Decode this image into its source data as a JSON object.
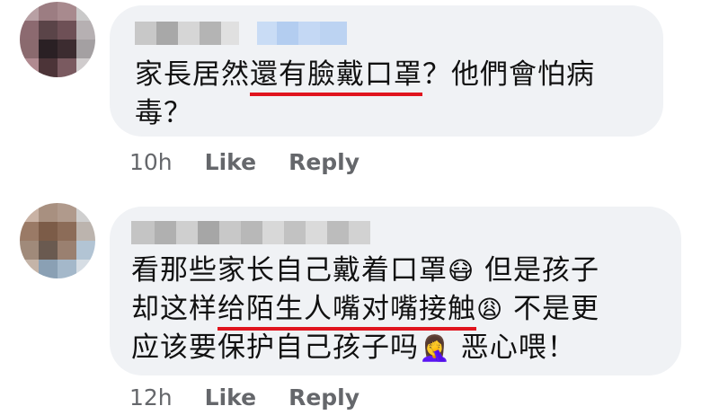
{
  "comments": [
    {
      "text_lines": [
        [
          {
            "t": "家長居然",
            "u": false
          },
          {
            "t": "還有臉戴口罩",
            "u": true
          },
          {
            "t": "？他們會怕病",
            "u": false
          }
        ],
        [
          {
            "t": "毒？",
            "u": false
          }
        ]
      ],
      "time": "10h",
      "like_label": "Like",
      "reply_label": "Reply"
    },
    {
      "text_lines": [
        [
          {
            "t": "看那些家长自己戴着口罩",
            "u": false
          },
          {
            "t": "😷",
            "u": false,
            "emoji": true
          },
          {
            "t": " 但是孩子",
            "u": false
          }
        ],
        [
          {
            "t": "却这样",
            "u": false
          },
          {
            "t": "给陌生人嘴对嘴接触",
            "u": true
          },
          {
            "t": "😩",
            "u": false,
            "emoji": true
          },
          {
            "t": " 不是更",
            "u": false
          }
        ],
        [
          {
            "t": "应该要保护自己孩子吗",
            "u": false
          },
          {
            "t": "🤦‍♀️",
            "u": false,
            "emoji": true
          },
          {
            "t": " 恶心喂！",
            "u": false
          }
        ]
      ],
      "time": "12h",
      "like_label": "Like",
      "reply_label": "Reply"
    }
  ],
  "colors": {
    "bubble": "#f0f2f5",
    "underline": "#e0141e",
    "meta": "#65676b"
  }
}
